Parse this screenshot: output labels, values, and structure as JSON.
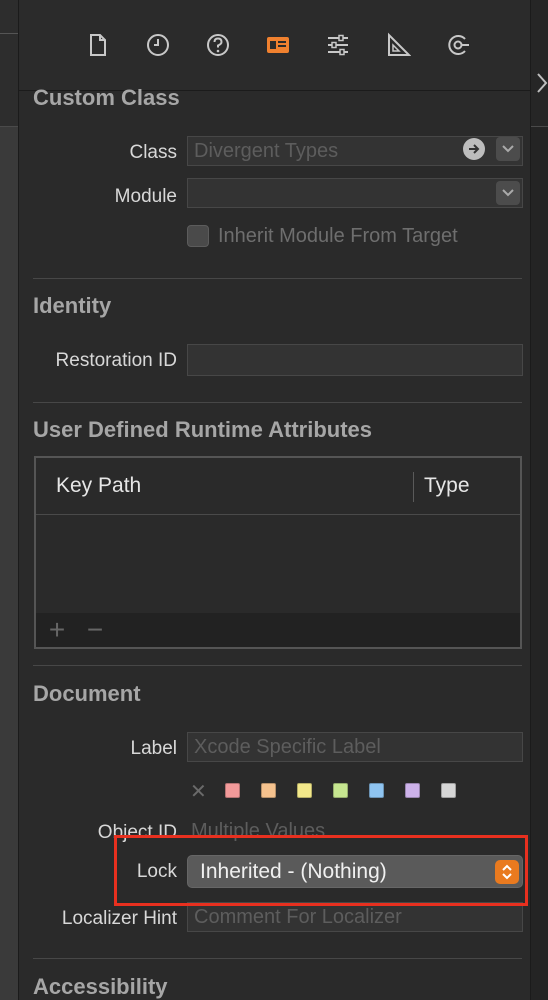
{
  "toolbar": {
    "icons": [
      "file-icon",
      "clock-icon",
      "help-icon",
      "identity-inspector-icon",
      "sliders-icon",
      "ruler-icon",
      "connections-icon"
    ],
    "active_icon": "identity-inspector-icon",
    "accent": "#f0812f"
  },
  "custom_class": {
    "title": "Custom Class",
    "class_label": "Class",
    "class_placeholder": "Divergent Types",
    "module_label": "Module",
    "module_value": "",
    "inherit_label": "Inherit Module From Target",
    "inherit_checked": false
  },
  "identity": {
    "title": "Identity",
    "restoration_label": "Restoration ID",
    "restoration_value": ""
  },
  "runtime_attributes": {
    "title": "User Defined Runtime Attributes",
    "columns": [
      "Key Path",
      "Type"
    ],
    "rows": [],
    "add_symbol": "+",
    "remove_symbol": "−"
  },
  "document": {
    "title": "Document",
    "label_label": "Label",
    "label_placeholder": "Xcode Specific Label",
    "clear_symbol": "✕",
    "swatches": [
      "#f29a9a",
      "#f5c28e",
      "#f2e88a",
      "#c6e690",
      "#8fc4f0",
      "#cdb2ea",
      "#d6d6d6"
    ],
    "object_id_label": "Object ID",
    "object_id_value": "Multiple Values",
    "lock_label": "Lock",
    "lock_value": "Inherited - (Nothing)",
    "localizer_label": "Localizer Hint",
    "localizer_placeholder": "Comment For Localizer"
  },
  "accessibility": {
    "title": "Accessibility"
  },
  "highlight_color": "#e8301f"
}
